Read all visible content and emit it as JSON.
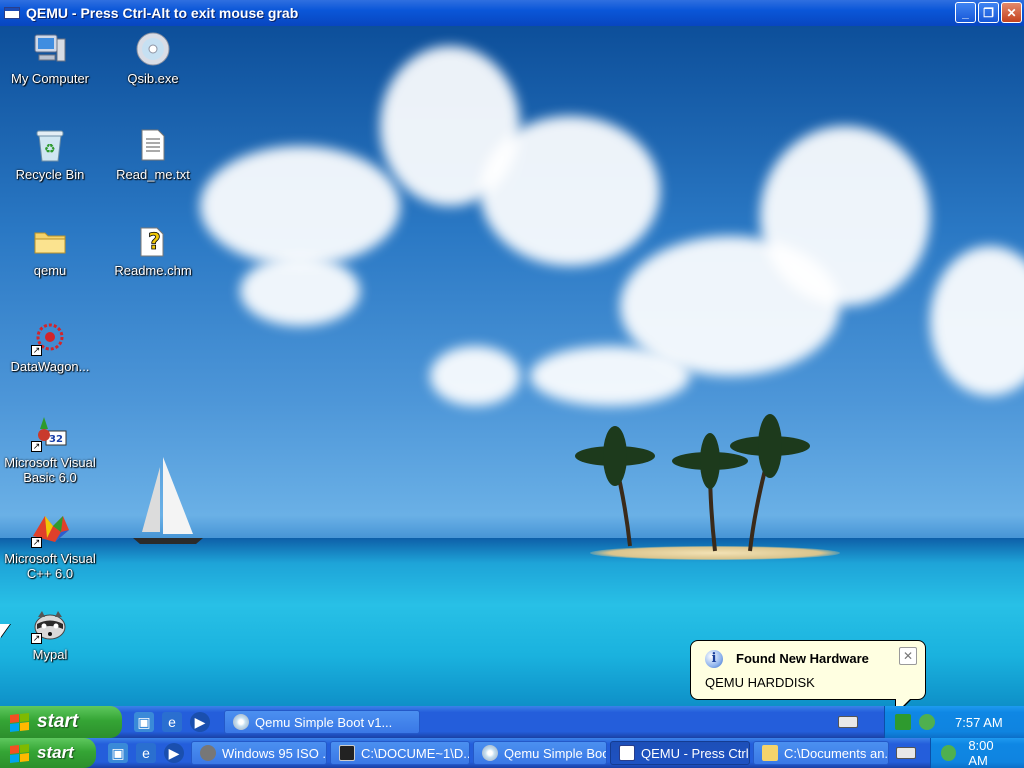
{
  "window": {
    "title": "QEMU - Press Ctrl-Alt to exit mouse grab",
    "buttons": {
      "minimize": "_",
      "restore": "❐",
      "close": "✕"
    }
  },
  "desktop_icons": [
    {
      "label": "My Computer",
      "icon": "my-computer-icon"
    },
    {
      "label": "Qsib.exe",
      "icon": "cd-icon"
    },
    {
      "label": "Recycle Bin",
      "icon": "recycle-bin-icon"
    },
    {
      "label": "Read_me.txt",
      "icon": "text-file-icon"
    },
    {
      "label": "qemu",
      "icon": "folder-icon"
    },
    {
      "label": "Readme.chm",
      "icon": "help-file-icon"
    },
    {
      "label": "DataWagon...",
      "icon": "datawagon-icon"
    },
    {
      "label": "Microsoft Visual Basic 6.0",
      "icon": "vb6-icon"
    },
    {
      "label": "Microsoft Visual C++ 6.0",
      "icon": "vc6-icon"
    },
    {
      "label": "Mypal",
      "icon": "raccoon-icon"
    }
  ],
  "balloon": {
    "title": "Found New Hardware",
    "text": "QEMU HARDDISK",
    "close": "✕"
  },
  "inner_taskbar": {
    "start_label": "start",
    "tasks": [
      {
        "label": "Qemu Simple Boot v1..."
      }
    ],
    "clock": "7:57 AM"
  },
  "outer_taskbar": {
    "start_label": "start",
    "tasks": [
      {
        "label": "Windows 95 ISO ..."
      },
      {
        "label": "C:\\DOCUME~1\\D..."
      },
      {
        "label": "Qemu Simple Boo..."
      },
      {
        "label": "QEMU - Press Ctrl..."
      },
      {
        "label": "C:\\Documents an..."
      }
    ],
    "clock": "8:00 AM"
  },
  "colors": {
    "titlebar_blue": "#0a56d8",
    "taskbar_blue": "#245edb",
    "start_green": "#35a535",
    "tray_blue": "#0f87e4",
    "balloon_bg": "#ffffe1"
  }
}
